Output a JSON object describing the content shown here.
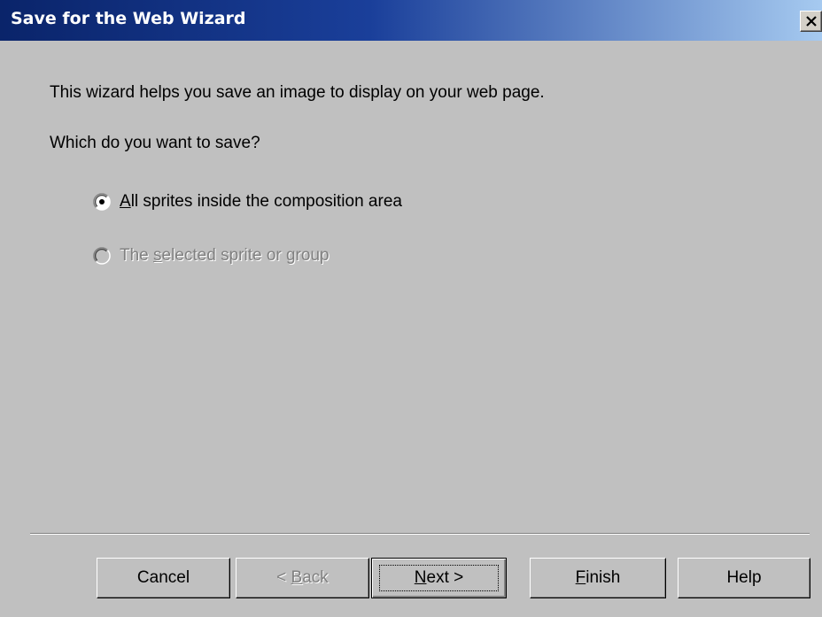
{
  "window": {
    "title": "Save for the Web Wizard",
    "close_glyph": "✕"
  },
  "content": {
    "intro_text": "This wizard helps you save an image to display on your web page.",
    "question_text": "Which do you want to save?"
  },
  "options": [
    {
      "mnemonic": "A",
      "rest": "ll sprites inside the composition area",
      "selected": true,
      "enabled": true
    },
    {
      "pre": "The ",
      "mnemonic": "s",
      "rest": "elected sprite or group",
      "selected": false,
      "enabled": false
    }
  ],
  "buttons": {
    "cancel": {
      "label": "Cancel"
    },
    "back": {
      "pre": "< ",
      "mnemonic": "B",
      "rest": "ack",
      "enabled": false
    },
    "next": {
      "mnemonic": "N",
      "rest": "ext >",
      "default": true
    },
    "finish": {
      "mnemonic": "F",
      "rest": "inish"
    },
    "help": {
      "label": "Help"
    }
  },
  "colors": {
    "titlebar_start": "#0a246a",
    "titlebar_end": "#a6caf0",
    "dialog_bg": "#c0c0c0",
    "disabled_text": "#808080"
  }
}
